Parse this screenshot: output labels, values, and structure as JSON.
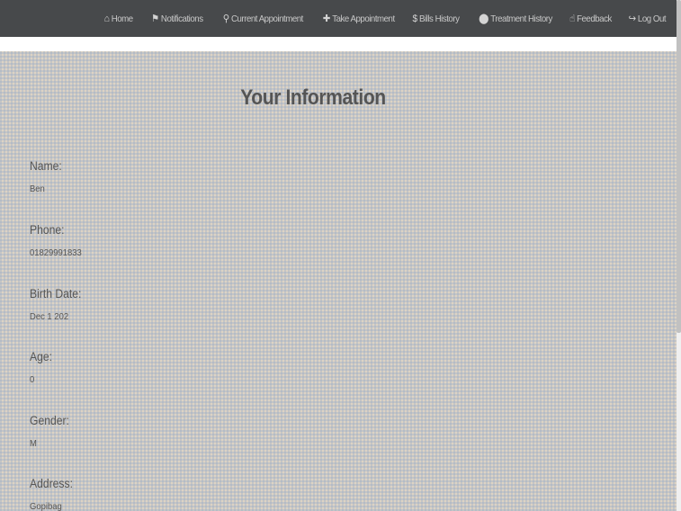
{
  "nav": {
    "items": [
      {
        "label": "Home",
        "icon": "⌂"
      },
      {
        "label": "Notifications",
        "icon": "⚑"
      },
      {
        "label": "Current Appointment",
        "icon": "⚲"
      },
      {
        "label": "Take Appointment",
        "icon": "✚"
      },
      {
        "label": "Bills History",
        "icon": "$"
      },
      {
        "label": "Treatment History",
        "icon": "⬤"
      },
      {
        "label": "Feedback",
        "icon": "☝"
      },
      {
        "label": "Log Out",
        "icon": "↪"
      }
    ]
  },
  "main": {
    "title": "Your Information",
    "fields": [
      {
        "label": "Name:",
        "value": "Ben"
      },
      {
        "label": "Phone:",
        "value": "01829991833"
      },
      {
        "label": "Birth Date:",
        "value": "Dec 1 202"
      },
      {
        "label": "Age:",
        "value": "0"
      },
      {
        "label": "Gender:",
        "value": "M"
      },
      {
        "label": "Address:",
        "value": "Gopibag"
      }
    ]
  }
}
